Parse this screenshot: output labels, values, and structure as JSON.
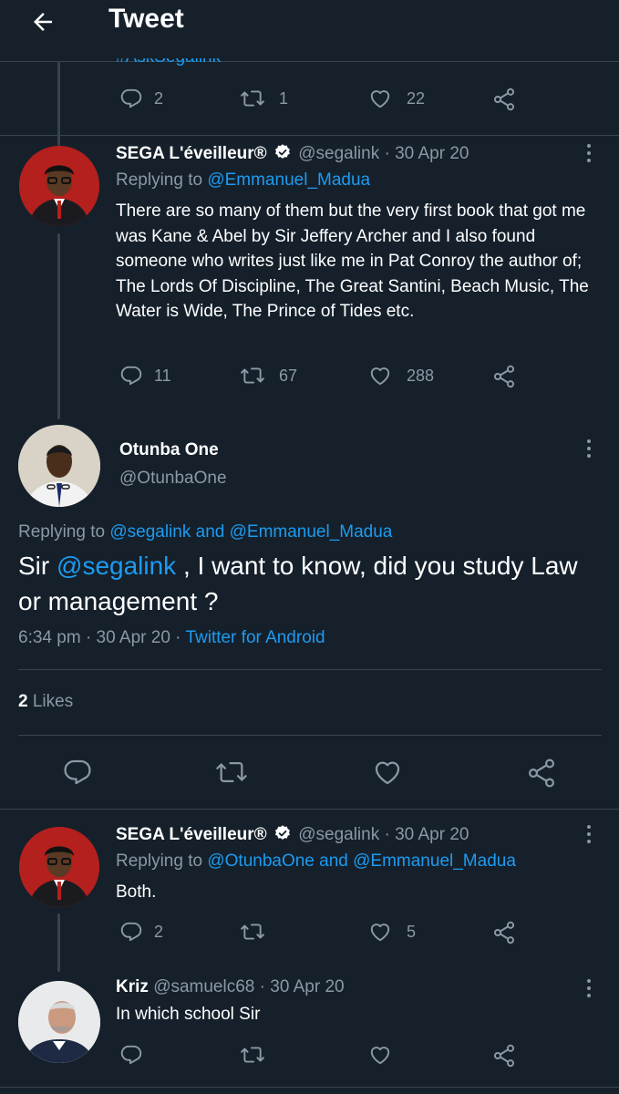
{
  "header": {
    "title": "Tweet"
  },
  "top_tweet": {
    "cut_text": "#AskSegalink",
    "reply_count": "2",
    "retweet_count": "1",
    "like_count": "22"
  },
  "reply1": {
    "name": "SEGA L'éveilleur®",
    "handle": "@segalink",
    "date": "· 30 Apr 20",
    "replying_prefix": "Replying to",
    "replying_to": "@Emmanuel_Madua",
    "text": "There are so many of them but the very first book that got me was Kane & Abel by Sir Jeffery Archer and I also found someone who writes just like me in Pat Conroy the author of; The Lords Of Discipline, The Great Santini, Beach Music, The Water is Wide, The Prince of Tides etc.",
    "reply_count": "11",
    "retweet_count": "67",
    "like_count": "288"
  },
  "main": {
    "name": "Otunba One",
    "handle": "@OtunbaOne",
    "replying_prefix": "Replying to",
    "replying_to_1": "@segalink",
    "replying_and": "and",
    "replying_to_2": "@Emmanuel_Madua",
    "text_prefix": "Sir",
    "mention": "@segalink",
    "text_suffix": ", I want to know, did you study Law or management ?",
    "time": "6:34 pm",
    "date": "· 30 Apr 20 ·",
    "source": "Twitter for Android",
    "likes_count": "2",
    "likes_label": "Likes"
  },
  "reply2": {
    "name": "SEGA L'éveilleur®",
    "handle": "@segalink",
    "date": "· 30 Apr 20",
    "replying_prefix": "Replying to",
    "replying_to": "@OtunbaOne and @Emmanuel_Madua",
    "text": "Both.",
    "reply_count": "2",
    "like_count": "5"
  },
  "reply3": {
    "name": "Kriz",
    "handle": "@samuelc68",
    "date": "· 30 Apr 20",
    "text": "In which school Sir"
  },
  "colors": {
    "background": "#15202b",
    "divider": "#38444d",
    "muted": "#8b98a5",
    "link": "#1d9bf0",
    "verified": "#ffffff"
  },
  "icons": [
    "back-arrow-icon",
    "reply-icon",
    "retweet-icon",
    "like-icon",
    "share-icon",
    "more-icon",
    "verified-icon"
  ]
}
